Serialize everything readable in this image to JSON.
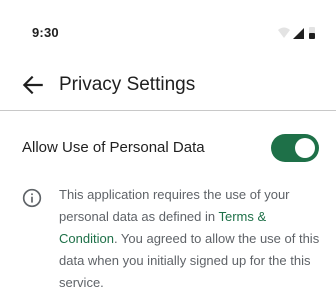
{
  "status_bar": {
    "time": "9:30",
    "icons": [
      "wifi-icon",
      "cellular-signal-icon",
      "battery-icon"
    ]
  },
  "app_bar": {
    "back_icon": "arrow-back-icon",
    "title": "Privacy Settings"
  },
  "setting": {
    "label": "Allow Use of Personal Data",
    "enabled": true
  },
  "info": {
    "icon": "info-icon",
    "text_before": "This application requires the use of your personal data as defined in ",
    "link_text": "Terms & Condition",
    "text_after": ". You agreed to allow the use of this data when you initially signed up for the this service."
  },
  "colors": {
    "accent": "#1e7048",
    "text_primary": "#1f1f1f",
    "text_secondary": "#5f6368",
    "divider": "#c8c8c8"
  }
}
